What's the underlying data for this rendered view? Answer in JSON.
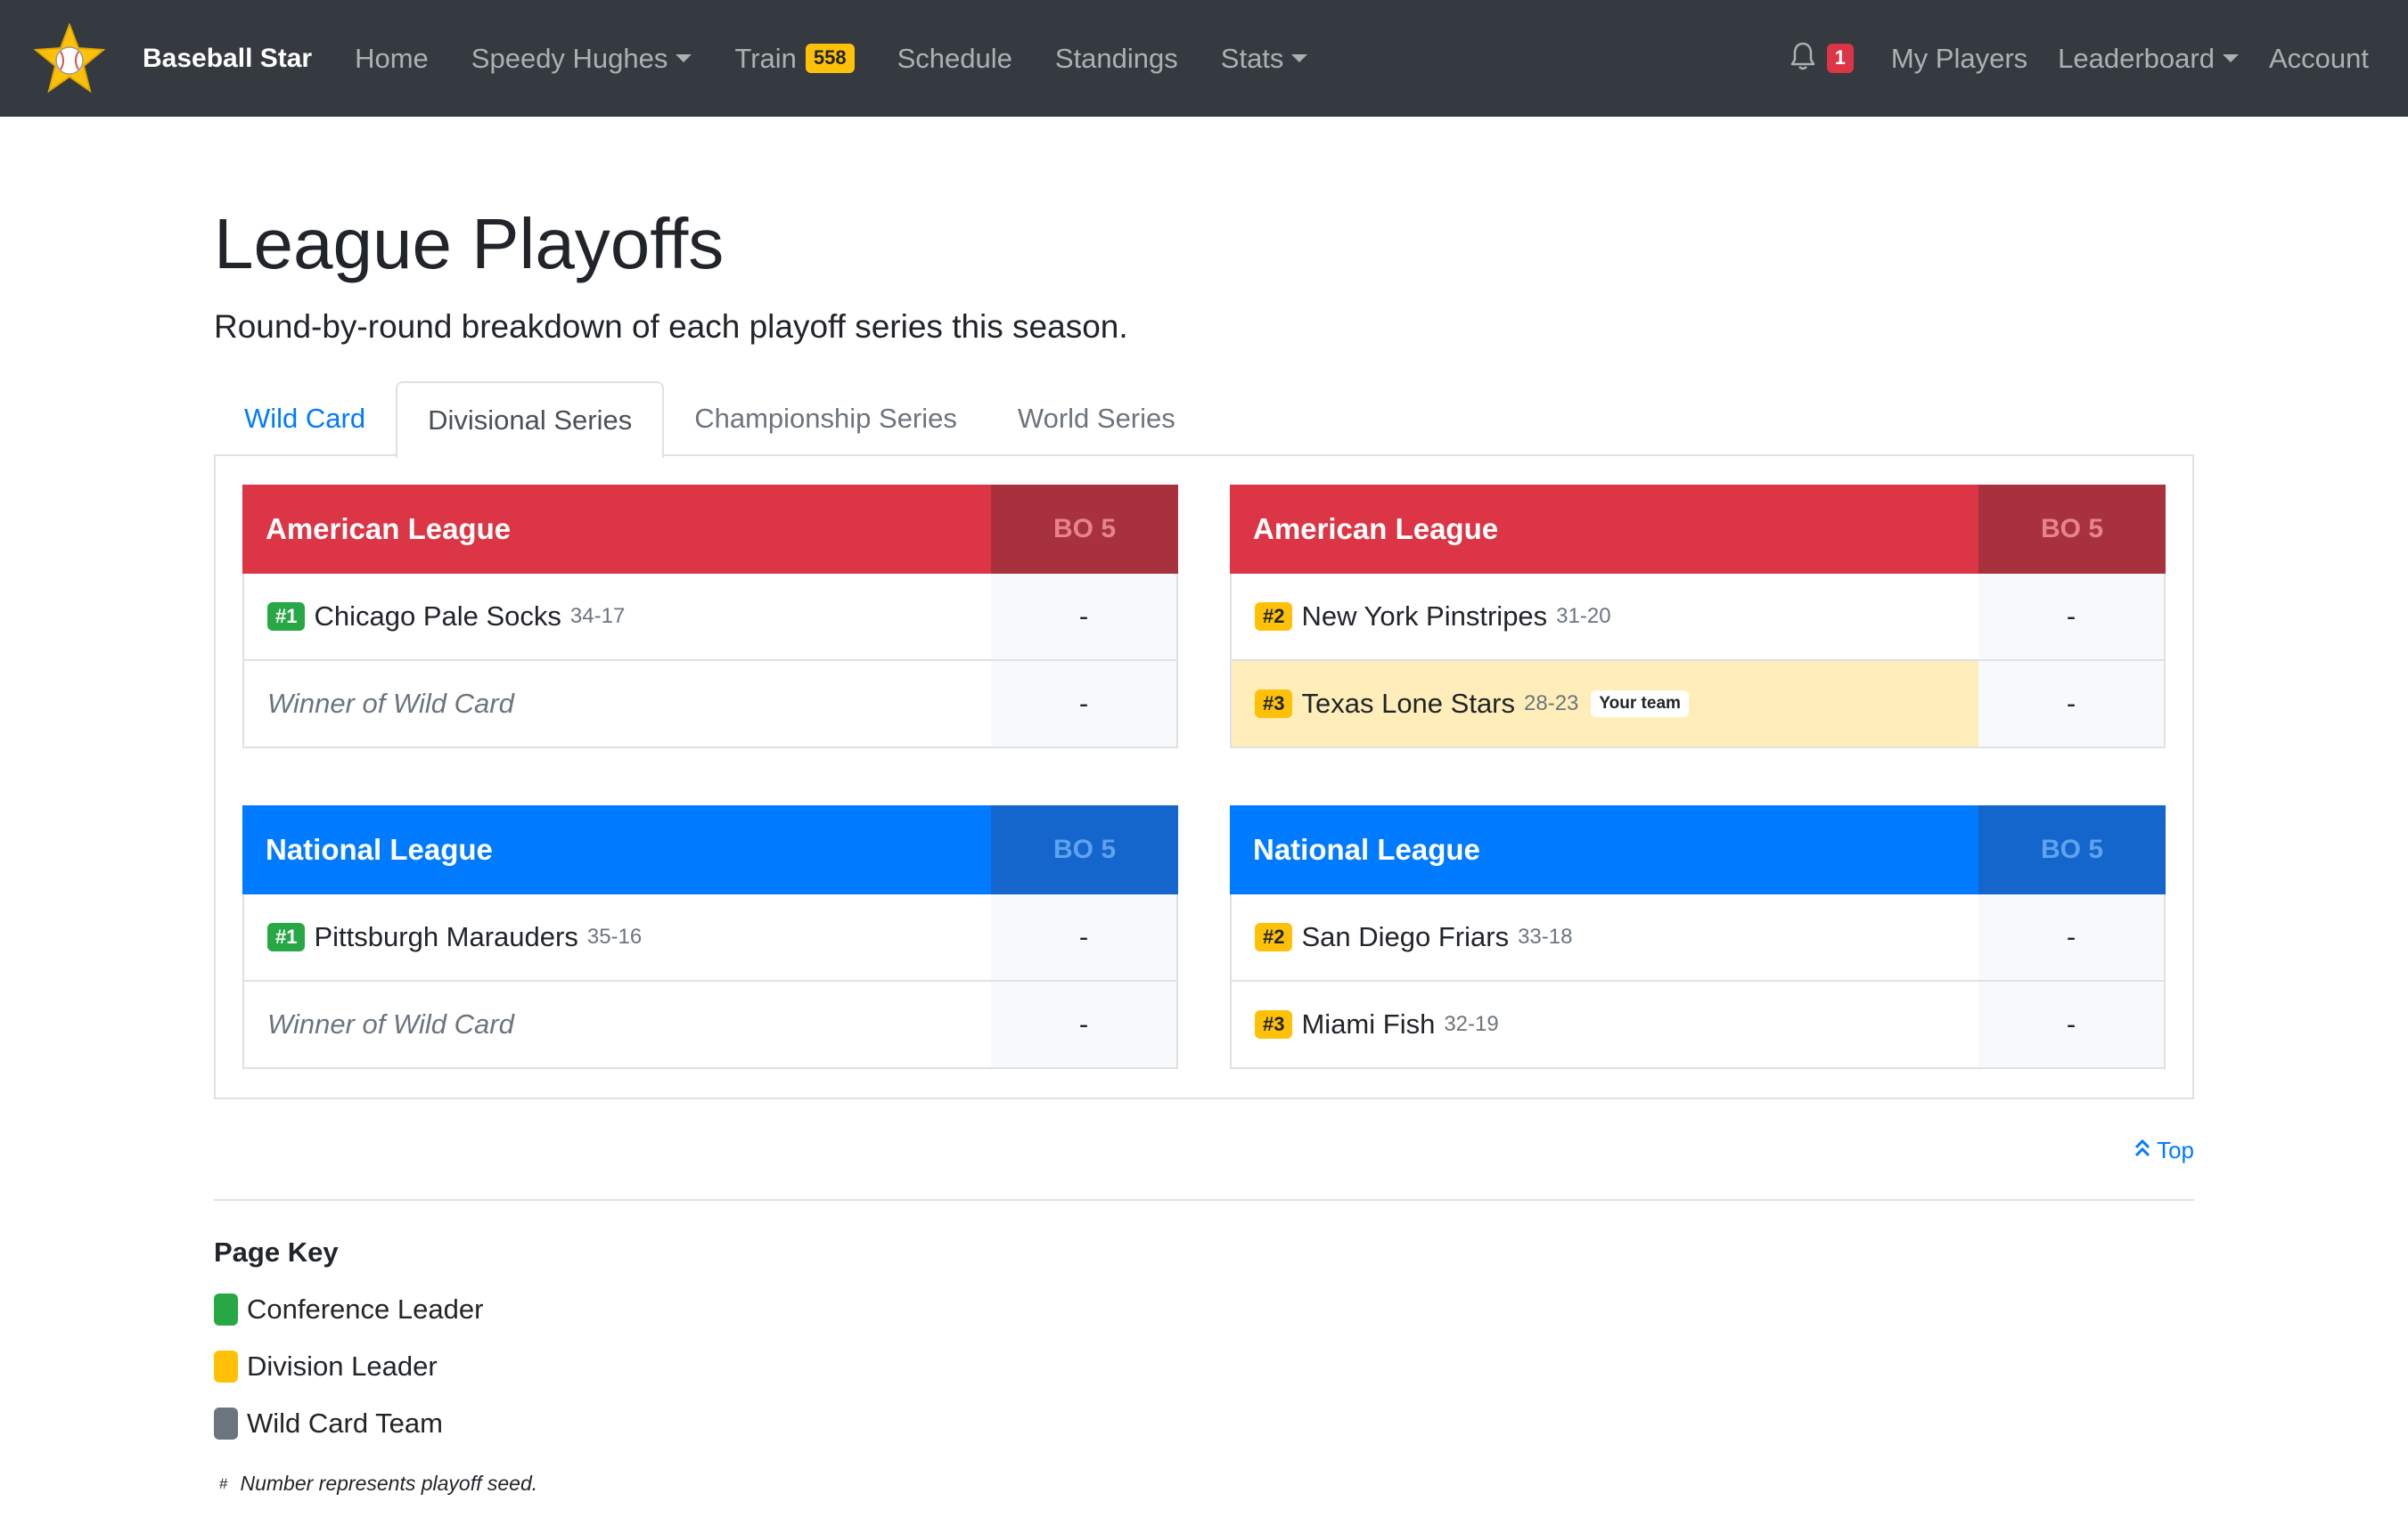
{
  "navbar": {
    "brand": "Baseball Star",
    "items": [
      {
        "label": "Home"
      },
      {
        "label": "Speedy Hughes"
      },
      {
        "label": "Train",
        "badge": "558"
      },
      {
        "label": "Schedule"
      },
      {
        "label": "Standings"
      },
      {
        "label": "Stats"
      }
    ],
    "notifications_count": "1",
    "right_items": [
      {
        "label": "My Players"
      },
      {
        "label": "Leaderboard"
      },
      {
        "label": "Account"
      }
    ]
  },
  "header": {
    "title": "League Playoffs",
    "lead": "Round-by-round breakdown of each playoff series this season."
  },
  "tabs": [
    {
      "label": "Wild Card"
    },
    {
      "label": "Divisional Series"
    },
    {
      "label": "Championship Series"
    },
    {
      "label": "World Series"
    }
  ],
  "series": [
    {
      "league": "American League",
      "format": "BO 5",
      "teams": [
        {
          "seed": "#1",
          "name": "Chicago Pale Socks",
          "record": "34-17",
          "score": "-"
        },
        {
          "name": "Winner of Wild Card",
          "score": "-"
        }
      ]
    },
    {
      "league": "American League",
      "format": "BO 5",
      "teams": [
        {
          "seed": "#2",
          "name": "New York Pinstripes",
          "record": "31-20",
          "score": "-"
        },
        {
          "seed": "#3",
          "name": "Texas Lone Stars",
          "record": "28-23",
          "tag": "Your team",
          "score": "-"
        }
      ]
    },
    {
      "league": "National League",
      "format": "BO 5",
      "teams": [
        {
          "seed": "#1",
          "name": "Pittsburgh Marauders",
          "record": "35-16",
          "score": "-"
        },
        {
          "name": "Winner of Wild Card",
          "score": "-"
        }
      ]
    },
    {
      "league": "National League",
      "format": "BO 5",
      "teams": [
        {
          "seed": "#2",
          "name": "San Diego Friars",
          "record": "33-18",
          "score": "-"
        },
        {
          "seed": "#3",
          "name": "Miami Fish",
          "record": "32-19",
          "score": "-"
        }
      ]
    }
  ],
  "top_link": "Top",
  "page_key": {
    "title": "Page Key",
    "items": [
      {
        "label": "Conference Leader",
        "color": "#28a745"
      },
      {
        "label": "Division Leader",
        "color": "#ffc107"
      },
      {
        "label": "Wild Card Team",
        "color": "#6c757d"
      }
    ],
    "note_symbol": "#",
    "note": "Number represents playoff seed."
  }
}
